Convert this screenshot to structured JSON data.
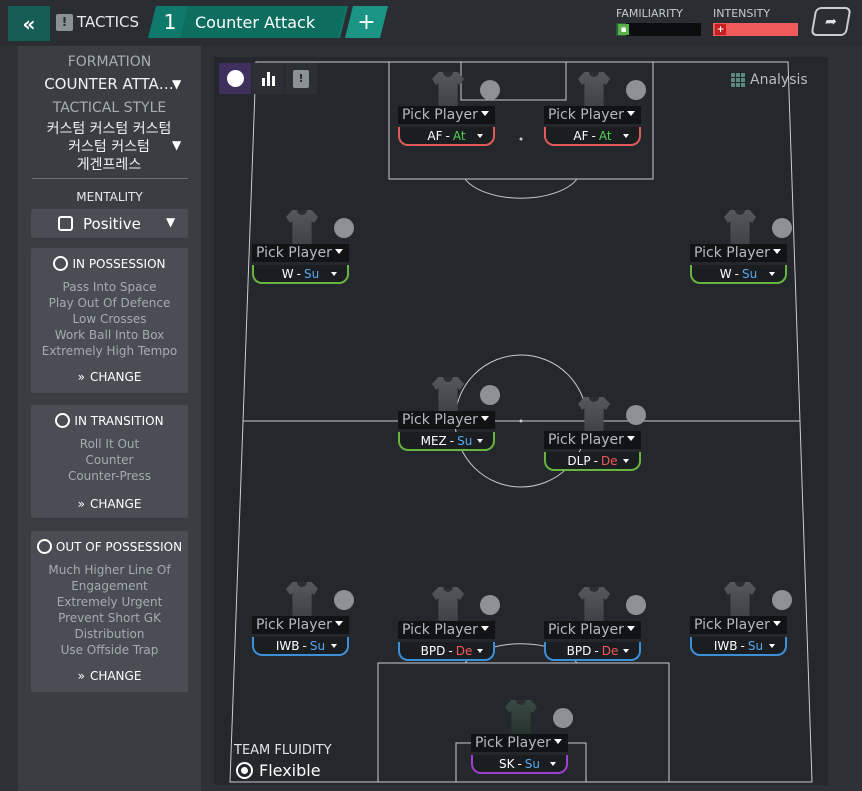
{
  "topbar": {
    "back_label": "«",
    "tactics_label": "TACTICS",
    "tactic_slot_number": "1",
    "tactic_name": "Counter Attack",
    "add_label": "+",
    "familiarity_label": "FAMILIARITY",
    "familiarity_level": 0.12,
    "intensity_label": "INTENSITY",
    "intensity_level": 1.0
  },
  "sidebar": {
    "formation_label": "FORMATION",
    "formation_value": "COUNTER ATTA…",
    "style_label": "TACTICAL STYLE",
    "style_value_line1": "커스텀 커스텀 커스텀",
    "style_value_line2": "커스텀 커스텀",
    "style_value_line3": "게겐프레스",
    "mentality_label": "MENTALITY",
    "mentality_value": "Positive",
    "in_possession": {
      "title": "IN POSSESSION",
      "items": [
        "Pass Into Space",
        "Play Out Of Defence",
        "Low Crosses",
        "Work Ball Into Box",
        "Extremely High Tempo"
      ],
      "change_label": "CHANGE"
    },
    "in_transition": {
      "title": "IN TRANSITION",
      "items": [
        "Roll It Out",
        "Counter",
        "Counter-Press"
      ],
      "change_label": "CHANGE"
    },
    "out_of_possession": {
      "title": "OUT OF POSSESSION",
      "items": [
        "Much Higher Line Of",
        "Engagement",
        "Extremely Urgent",
        "Prevent Short GK",
        "Distribution",
        "Use Offside Trap"
      ],
      "change_label": "CHANGE"
    }
  },
  "pitch": {
    "analysis_label": "Analysis",
    "team_fluidity_label": "TEAM FLUIDITY",
    "team_fluidity_value": "Flexible",
    "pick_label": "Pick Player",
    "players": [
      {
        "role": "AF",
        "duty": "At"
      },
      {
        "role": "AF",
        "duty": "At"
      },
      {
        "role": "W",
        "duty": "Su"
      },
      {
        "role": "W",
        "duty": "Su"
      },
      {
        "role": "MEZ",
        "duty": "Su"
      },
      {
        "role": "DLP",
        "duty": "De"
      },
      {
        "role": "IWB",
        "duty": "Su"
      },
      {
        "role": "BPD",
        "duty": "De"
      },
      {
        "role": "BPD",
        "duty": "De"
      },
      {
        "role": "IWB",
        "duty": "Su"
      },
      {
        "role": "SK",
        "duty": "Su"
      }
    ]
  },
  "colors": {
    "accent_teal": "#0f7a6b",
    "attack": "#e05a5a",
    "support": "#67b53e",
    "defend": "#3d8fd8",
    "keeper": "#a040d0"
  }
}
